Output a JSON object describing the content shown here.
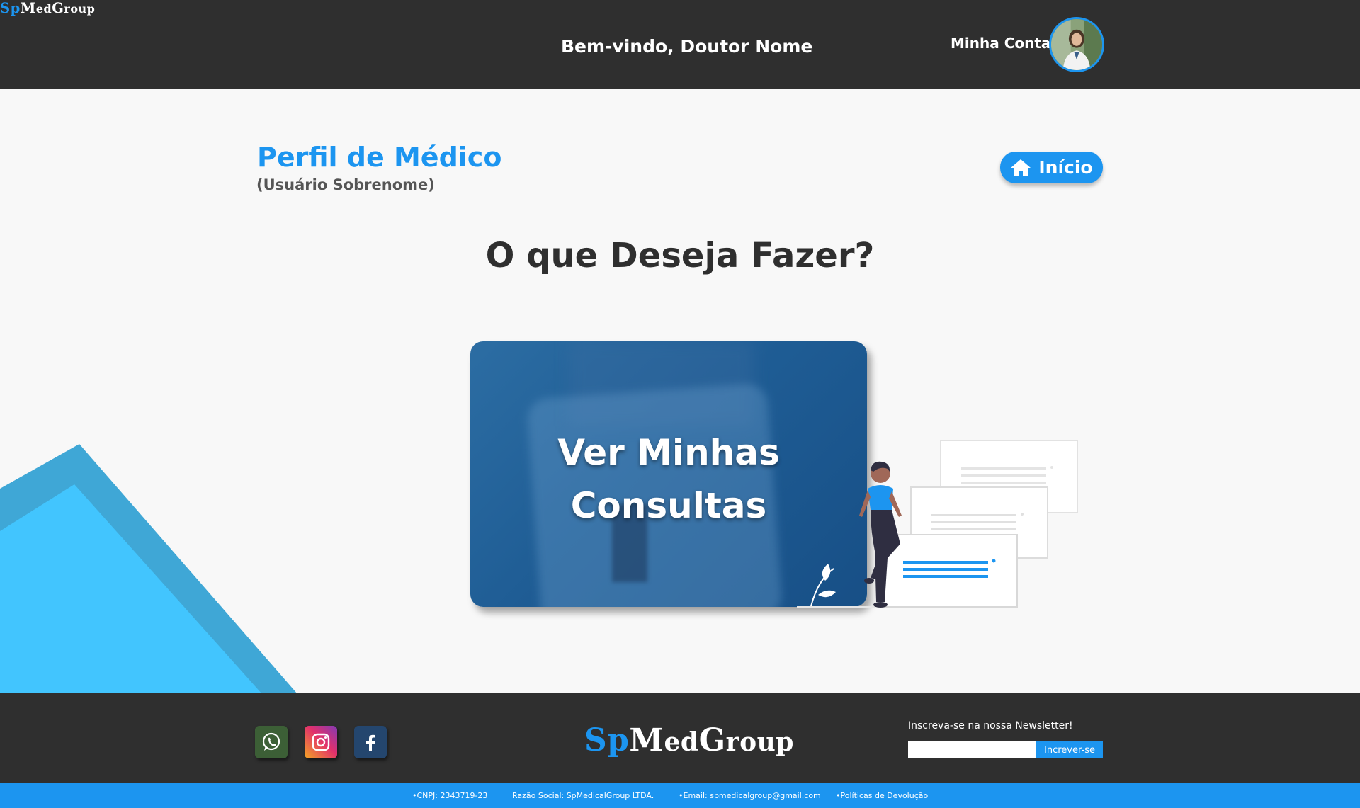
{
  "header": {
    "logo": {
      "sp": "Sp",
      "med_first": "M",
      "med_rest": "ed",
      "group_first": "G",
      "group_rest": "roup"
    },
    "welcome": "Bem-vindo, Doutor Nome",
    "account_label": "Minha Conta"
  },
  "profile": {
    "title": "Perfil de Médico",
    "subtitle": "(Usuário Sobrenome)"
  },
  "home_button": {
    "label": "Início"
  },
  "question": "O que Deseja Fazer?",
  "card": {
    "line1": "Ver Minhas",
    "line2": "Consultas"
  },
  "footer": {
    "social": [
      "whatsapp-icon",
      "instagram-icon",
      "facebook-icon"
    ],
    "newsletter": {
      "label": "Inscreva-se na nossa Newsletter!",
      "input_value": "",
      "button": "Increver-se"
    },
    "bottom": {
      "cnpj": "•CNPJ: 2343719-23",
      "razao": "Razão Social: SpMedicalGroup LTDA.",
      "email": "•Email: spmedicalgroup@gmail.com",
      "politicas": "•Políticas de Devolução"
    }
  },
  "colors": {
    "accent": "#1c95f0",
    "dark": "#2f2f2f",
    "light_blue": "#42c5fe",
    "mid_blue": "#3fa7d6"
  }
}
